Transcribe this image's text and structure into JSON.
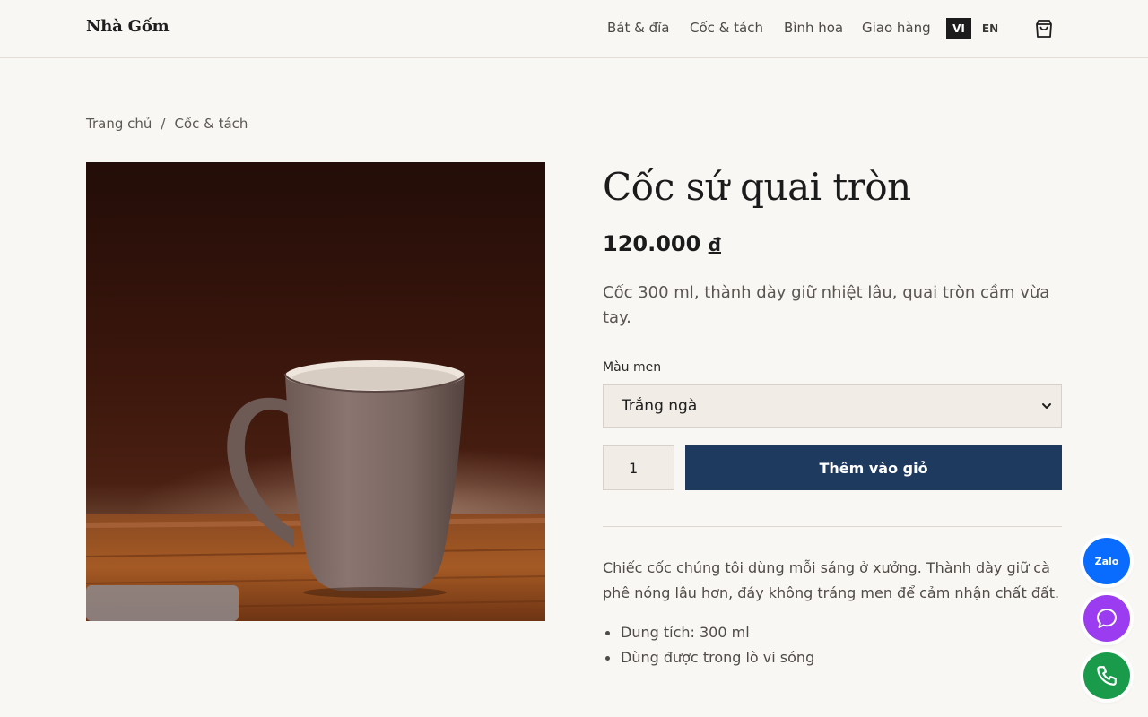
{
  "header": {
    "logo": "Nhà Gốm",
    "nav": [
      {
        "label": "Bát & đĩa"
      },
      {
        "label": "Cốc & tách"
      },
      {
        "label": "Bình hoa"
      },
      {
        "label": "Giao hàng"
      }
    ],
    "lang_active": "VI",
    "lang_other": "EN",
    "cart_icon": "shopping-bag-icon"
  },
  "breadcrumb": {
    "home": "Trang chủ",
    "separator": "/",
    "current": "Cốc & tách"
  },
  "product": {
    "title": "Cốc sứ quai tròn",
    "price": "120.000",
    "currency": "đ",
    "short_description": "Cốc 300 ml, thành dày giữ nhiệt lâu, quai tròn cầm vừa tay.",
    "option_label": "Màu men",
    "option_selected": "Trắng ngà",
    "quantity": "1",
    "add_to_cart": "Thêm vào giỏ",
    "long_description": "Chiếc cốc chúng tôi dùng mỗi sáng ở xưởng. Thành dày giữ cà phê nóng lâu hơn, đáy không tráng men để cảm nhận chất đất.",
    "features": [
      "Dung tích: 300 ml",
      "Dùng được trong lò vi sóng"
    ]
  },
  "floating": {
    "zalo_label": "Zalo",
    "chat_icon": "chat-bubble-icon",
    "phone_icon": "phone-icon"
  },
  "colors": {
    "background": "#f9f7f3",
    "primary_button": "#1e3a5f",
    "zalo": "#0a6cff",
    "messenger": "#9b3cf0",
    "phone": "#1a9b4b"
  }
}
